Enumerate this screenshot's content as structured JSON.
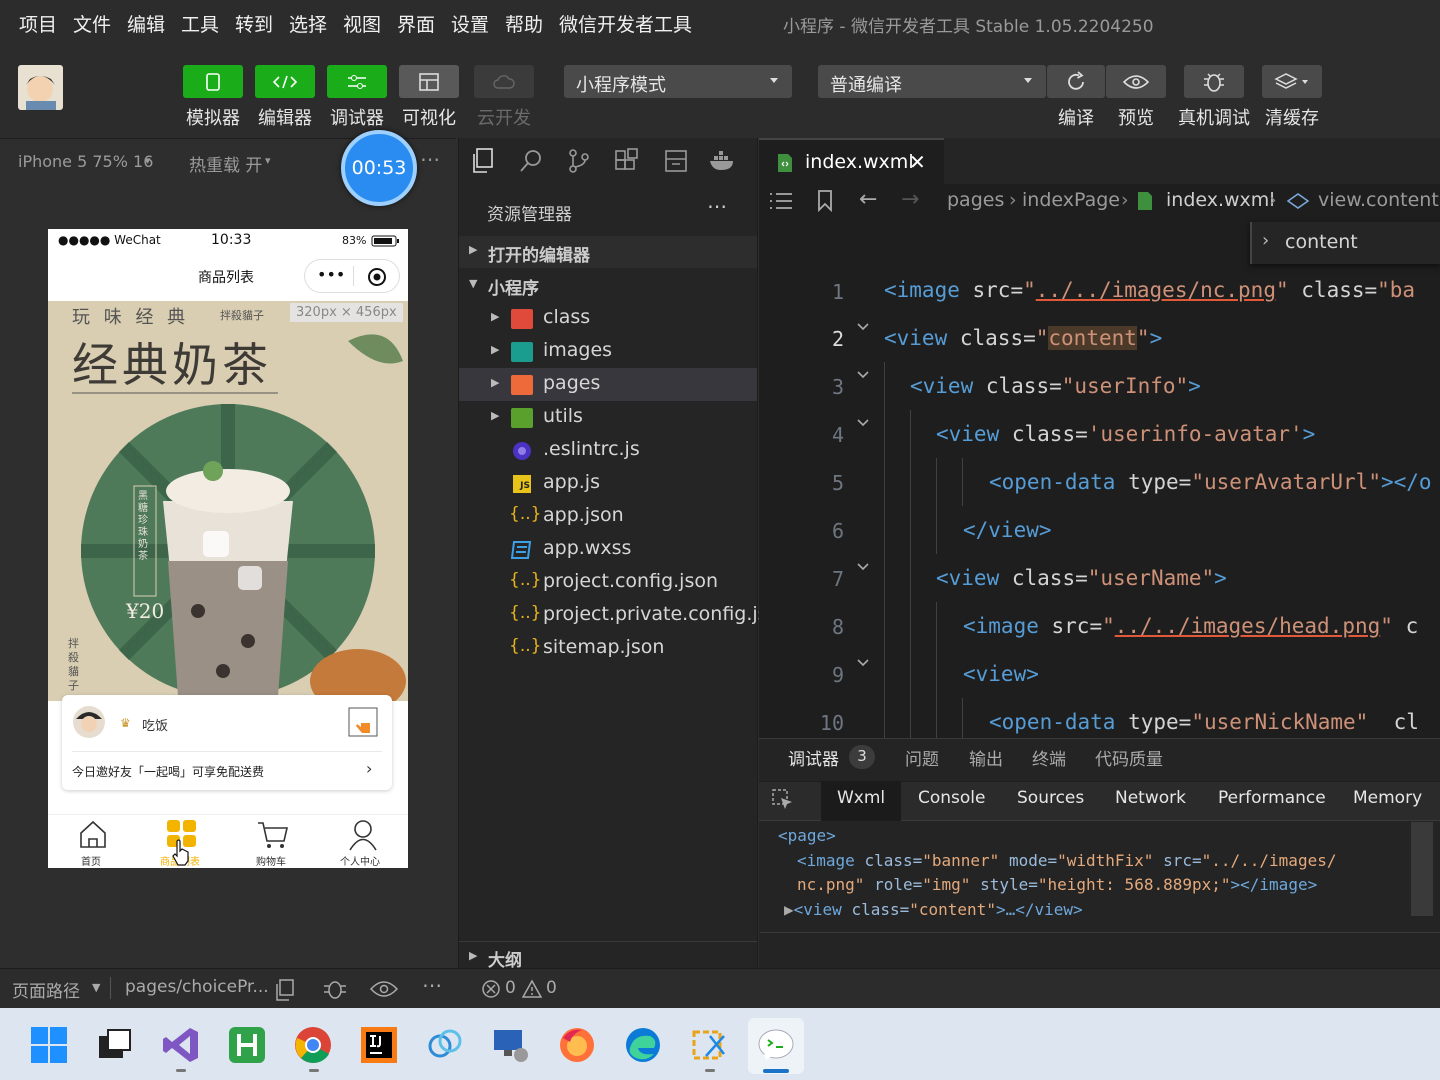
{
  "menubar": {
    "items": [
      "项目",
      "文件",
      "编辑",
      "工具",
      "转到",
      "选择",
      "视图",
      "界面",
      "设置",
      "帮助",
      "微信开发者工具"
    ],
    "title": "小程序 - 微信开发者工具 Stable 1.05.2204250"
  },
  "toolbar": {
    "simulator": "模拟器",
    "editor": "编辑器",
    "debugger": "调试器",
    "visual": "可视化",
    "cloud": "云开发",
    "mode_select": "小程序模式",
    "compile_select": "普通编译",
    "compile": "编译",
    "preview": "预览",
    "real_debug": "真机调试",
    "clear_cache": "清缓存"
  },
  "simulator": {
    "device": "iPhone 5 75% 16",
    "hotreload": "热重载 开",
    "timer": "00:53",
    "status_carrier": "●●●●● WeChat",
    "status_time": "10:33",
    "status_battery": "83%",
    "nav_title": "商品列表",
    "size_badge": "320px × 456px",
    "banner_top": "玩 味 经 典",
    "banner_brand": "拌殺貓子",
    "banner_title": "经典奶茶",
    "banner_side": "黑糖珍珠奶茶",
    "price": "¥20",
    "banner_vertical": "拌殺貓子",
    "card_name": "吃饭",
    "card_invite": "今日邀好友「一起喝」可享免配送费",
    "tabs": [
      "首页",
      "商品列表",
      "购物车",
      "个人中心"
    ]
  },
  "explorer": {
    "header": "资源管理器",
    "open_editors": "打开的编辑器",
    "project": "小程序",
    "items": [
      "class",
      "images",
      "pages",
      "utils",
      ".eslintrc.js",
      "app.js",
      "app.json",
      "app.wxss",
      "project.config.json",
      "project.private.config.js...",
      "sitemap.json"
    ],
    "outline": "大纲"
  },
  "editor": {
    "tab": "index.wxml",
    "crumbs": [
      "pages",
      "indexPage",
      "index.wxml",
      "view.content"
    ],
    "crumb_popup": "content",
    "lines": [
      "1",
      "2",
      "3",
      "4",
      "5",
      "6",
      "7",
      "8",
      "9",
      "10"
    ]
  },
  "debugger": {
    "tabs": [
      "调试器",
      "问题",
      "输出",
      "终端",
      "代码质量"
    ],
    "badge": "3",
    "subtabs": [
      "Wxml",
      "Console",
      "Sources",
      "Network",
      "Performance",
      "Memory"
    ]
  },
  "status": {
    "path_label": "页面路径",
    "path": "pages/choicePr...",
    "errors": "0",
    "warnings": "0"
  }
}
